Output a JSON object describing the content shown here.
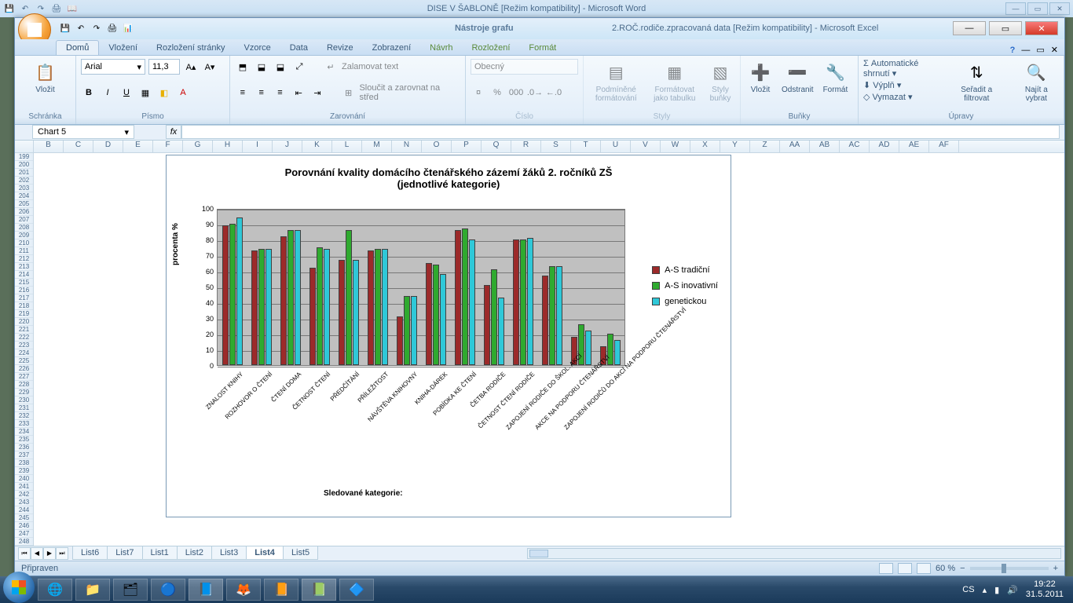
{
  "word_title": "DISE V ŠABLONĚ [Režim kompatibility] - Microsoft Word",
  "excel": {
    "context_tab": "Nástroje grafu",
    "doc_title": "2.ROČ.rodiče.zpracovaná data  [Režim kompatibility] - Microsoft Excel",
    "tabs": [
      "Domů",
      "Vložení",
      "Rozložení stránky",
      "Vzorce",
      "Data",
      "Revize",
      "Zobrazení",
      "Návrh",
      "Rozložení",
      "Formát"
    ],
    "active_tab": "Domů",
    "ribbon": {
      "clipboard": {
        "paste": "Vložit",
        "label": "Schránka"
      },
      "font": {
        "name": "Arial",
        "size": "11,3",
        "label": "Písmo"
      },
      "align": {
        "wrap": "Zalamovat text",
        "merge": "Sloučit a zarovnat na střed",
        "label": "Zarovnání"
      },
      "number": {
        "format": "Obecný",
        "label": "Číslo"
      },
      "styles": {
        "cond": "Podmíněné formátování",
        "table": "Formátovat jako tabulku",
        "cell": "Styly buňky",
        "label": "Styly"
      },
      "cells": {
        "insert": "Vložit",
        "delete": "Odstranit",
        "format": "Formát",
        "label": "Buňky"
      },
      "editing": {
        "sum": "Automatické shrnutí",
        "fill": "Výplň",
        "clear": "Vymazat",
        "sort": "Seřadit a filtrovat",
        "find": "Najít a vybrat",
        "label": "Úpravy"
      }
    },
    "namebox": "Chart 5",
    "fx": "fx",
    "sheets": [
      "List6",
      "List7",
      "List1",
      "List2",
      "List3",
      "List4",
      "List5"
    ],
    "active_sheet": "List4",
    "status": "Připraven",
    "zoom": "60 %"
  },
  "taskbar": {
    "lang": "CS",
    "time": "19:22",
    "date": "31.5.2011"
  },
  "chart_data": {
    "type": "bar",
    "title": "Porovnání kvality domácího čtenářského zázemí žáků  2. ročníků ZŠ\n(jednotlivé kategorie)",
    "ylabel": "procenta %",
    "xlabel": "Sledované kategorie:",
    "ylim": [
      0,
      100
    ],
    "yticks": [
      0,
      10,
      20,
      30,
      40,
      50,
      60,
      70,
      80,
      90,
      100
    ],
    "categories": [
      "ZNALOST KNIHY",
      "ROZHOVOR O ČTENÍ",
      "ČTENÍ DOMA",
      "ČETNOST ČTENÍ",
      "PŘEDČÍTÁNÍ",
      "PŘÍLEŽITOST",
      "NÁVŠTĚVA KNIHOVNY",
      "KNIHA-DÁREK",
      "POBÍDKA KE ČTENÍ",
      "ČETBA RODIČE",
      "ČETNOST ČTENÍ RODIČE",
      "ZAPOJENÍ RODIČE DO ŠKOL. AKCÍ",
      "AKCE NA PODPORU ČTENÁŘSTVÍ",
      "ZAPOJENÍ RODIČŮ DO AKCÍ NA PODPORU ČTENÁŘSTVÍ"
    ],
    "series": [
      {
        "name": "A-S tradiční",
        "color": "#9c2a2a",
        "values": [
          89,
          73,
          82,
          62,
          67,
          73,
          31,
          65,
          86,
          51,
          80,
          57,
          18,
          12
        ]
      },
      {
        "name": "A-S inovativní",
        "color": "#2faa2f",
        "values": [
          90,
          74,
          86,
          75,
          86,
          74,
          44,
          64,
          87,
          61,
          80,
          63,
          26,
          20
        ]
      },
      {
        "name": "genetickou",
        "color": "#2fc8d8",
        "values": [
          94,
          74,
          86,
          74,
          67,
          74,
          44,
          58,
          80,
          43,
          81,
          63,
          22,
          16
        ]
      }
    ]
  }
}
